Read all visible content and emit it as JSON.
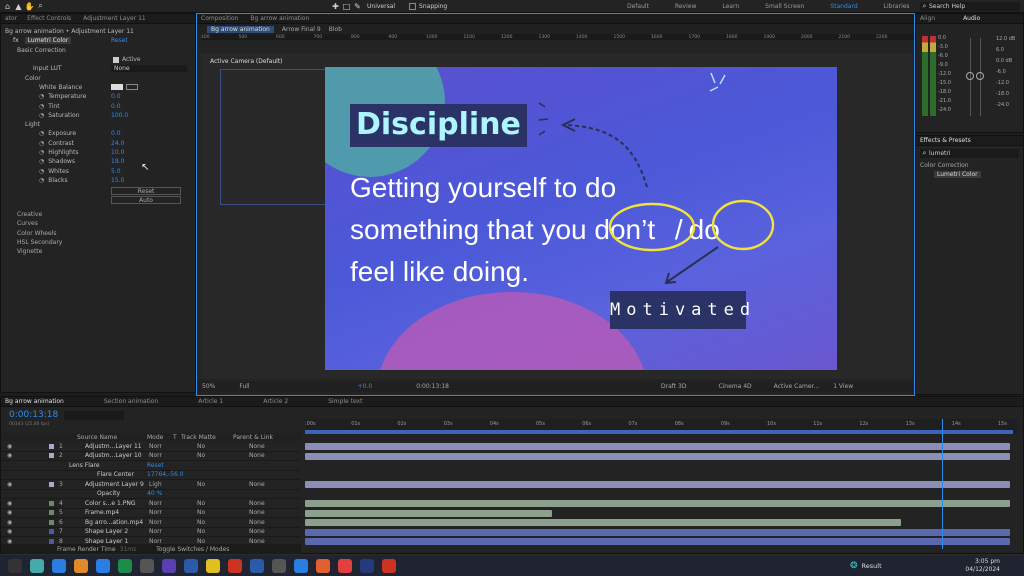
{
  "toolbar": {
    "universal": "Universal",
    "snapping": "Snapping",
    "search_placeholder": "Search Help",
    "workspaces": [
      "Default",
      "Review",
      "Learn",
      "Small Screen",
      "Standard",
      "Libraries"
    ]
  },
  "effect_controls": {
    "header_left": "ator",
    "tab": "Effect Controls",
    "tab_layer": "Adjustment Layer 11",
    "breadcrumb": "Bg arrow animation • Adjustment Layer 11",
    "fx": "fx",
    "effect_name": "Lumetri Color",
    "reset": "Reset",
    "basic_correction": "Basic Correction",
    "active_label": "Active",
    "input_lut_label": "Input LUT",
    "input_lut_value": "None",
    "color": "Color",
    "white_balance": "White Balance",
    "color_props": [
      {
        "label": "Temperature",
        "value": "0.0"
      },
      {
        "label": "Tint",
        "value": "0.0"
      },
      {
        "label": "Saturation",
        "value": "100.0"
      }
    ],
    "light": "Light",
    "light_props": [
      {
        "label": "Exposure",
        "value": "0.0"
      },
      {
        "label": "Contrast",
        "value": "24.0"
      },
      {
        "label": "Highlights",
        "value": "10.0"
      },
      {
        "label": "Shadows",
        "value": "19.0"
      },
      {
        "label": "Whites",
        "value": "5.0"
      },
      {
        "label": "Blacks",
        "value": "15.0"
      }
    ],
    "reset_button": "Reset",
    "auto_button": "Auto",
    "sections": [
      "Creative",
      "Curves",
      "Color Wheels",
      "HSL Secondary",
      "Vignette"
    ]
  },
  "composition": {
    "tab": "Composition",
    "tab_name": "Bg arrow animation",
    "flow": [
      "Bg arrow animation",
      "Arrow Final 9",
      "Blob"
    ],
    "ruler": [
      "400",
      "500",
      "600",
      "700",
      "800",
      "900",
      "1000",
      "1100",
      "1200",
      "1300",
      "1400",
      "1500",
      "1600",
      "1700",
      "1800",
      "1900",
      "2000",
      "2100",
      "2200"
    ],
    "camera_label": "Active Camera (Default)",
    "bottom": {
      "zoom": "50%",
      "quality": "Full",
      "exposure": "+0.0",
      "timecode": "0:00:13:18",
      "draft": "Draft 3D",
      "renderer": "Cinema 4D",
      "camera": "Active Camer...",
      "view": "1 View"
    }
  },
  "canvas": {
    "title": "Discipline",
    "line1": "Getting yourself to do",
    "line2a": "something that you",
    "dont": "don’t",
    "slash": "/",
    "do": "do",
    "line3": "feel like doing.",
    "motivated": "Motivated"
  },
  "audio": {
    "tabs": [
      "Align",
      "Audio"
    ],
    "db_right": [
      "12.0 dB",
      "6.0",
      "0.0 dB",
      "-6.0",
      "-12.0",
      "-18.0",
      "-24.0"
    ],
    "db_left": [
      "0.0",
      "-3.0",
      "-6.0",
      "-9.0",
      "-12.0",
      "-15.0",
      "-18.0",
      "-21.0",
      "-24.0"
    ]
  },
  "effects_presets": {
    "tab": "Effects & Presets",
    "search": "lumetri",
    "category": "Color Correction",
    "item": "Lumetri Color"
  },
  "timeline": {
    "tabs": [
      "Bg arrow animation",
      "Section animation",
      "Article 1",
      "Article 2",
      "Simple text"
    ],
    "timecode": "0:00:13:18",
    "fps": "00343 (25.00 fps)",
    "ticks": [
      ":00s",
      "01s",
      "02s",
      "03s",
      "04s",
      "05s",
      "06s",
      "07s",
      "08s",
      "09s",
      "10s",
      "11s",
      "12s",
      "13s",
      "14s",
      "15s"
    ],
    "columns": {
      "source": "Source Name",
      "mode": "Mode",
      "t": "T",
      "trackmatte": "Track Matte",
      "parent": "Parent & Link"
    },
    "layers": [
      {
        "num": "1",
        "name": "Adjustm...Layer 11",
        "mode": "Norr",
        "matte": "No",
        "parent": "None"
      },
      {
        "num": "2",
        "name": "Adjustm...Layer 10",
        "mode": "Norr",
        "matte": "No",
        "parent": "None"
      },
      {
        "num": "",
        "name": "Lens Flare",
        "mode": "",
        "matte": "",
        "parent": "",
        "reset": "Reset"
      },
      {
        "num": "",
        "name": "Flare Center",
        "value": "17764,-56.0"
      },
      {
        "num": "3",
        "name": "Adjustment Layer 9",
        "mode": "Ligh",
        "matte": "No",
        "parent": "None"
      },
      {
        "num": "",
        "name": "Opacity",
        "value": "40 %"
      },
      {
        "num": "4",
        "name": "Color s...e 1.PNG",
        "mode": "Norr",
        "matte": "No",
        "parent": "None"
      },
      {
        "num": "5",
        "name": "Frame.mp4",
        "mode": "Norr",
        "matte": "No",
        "parent": "None"
      },
      {
        "num": "6",
        "name": "Bg arro...ation.mp4",
        "mode": "Norr",
        "matte": "No",
        "parent": "None"
      },
      {
        "num": "7",
        "name": "Shape Layer 2",
        "mode": "Norr",
        "matte": "No",
        "parent": "None"
      },
      {
        "num": "8",
        "name": "Shape Layer 1",
        "mode": "Norr",
        "matte": "No",
        "parent": "None"
      }
    ],
    "footer_left": "Frame Render Time",
    "footer_ms": "31ms",
    "footer_toggle": "Toggle Switches / Modes"
  },
  "taskbar": {
    "weather": "Result",
    "time": "3:05 pm",
    "date": "04/12/2024"
  }
}
